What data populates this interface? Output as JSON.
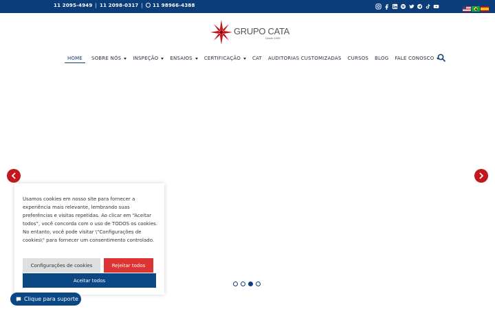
{
  "topbar": {
    "phone1": "11 2095-4949",
    "phone2": "11 2098-0317",
    "separator": "|",
    "whatsapp": "11 98966-4388",
    "social_icons": [
      "instagram-icon",
      "facebook-icon",
      "linkedin-icon",
      "spotify-icon",
      "twitter-icon",
      "telegram-icon",
      "tiktok-icon",
      "youtube-icon"
    ],
    "flags": [
      "us-flag-icon",
      "br-flag-icon",
      "es-flag-icon"
    ]
  },
  "logo": {
    "text": "GRUPO CATA",
    "sub": "Desde 1995"
  },
  "nav": {
    "items": [
      {
        "label": "HOME",
        "dropdown": false,
        "active": true
      },
      {
        "label": "SOBRE NÓS",
        "dropdown": true
      },
      {
        "label": "INSPEÇÃO",
        "dropdown": true
      },
      {
        "label": "ENSAIOS",
        "dropdown": true
      },
      {
        "label": "CERTIFICAÇÃO",
        "dropdown": true
      },
      {
        "label": "CAT",
        "dropdown": false
      },
      {
        "label": "AUDITORIAS CUSTOMIZADAS",
        "dropdown": false
      },
      {
        "label": "CURSOS",
        "dropdown": false
      },
      {
        "label": "BLOG",
        "dropdown": false
      },
      {
        "label": "FALE CONOSCO",
        "dropdown": true
      }
    ]
  },
  "slider": {
    "dot_count": 4,
    "active_dot": 3
  },
  "cookie": {
    "text": "Usamos cookies em nosso site para fornecer a experiência mais relevante, lembrando suas preferências e visitas repetidas. Ao clicar em “Aceitar todos”, você concorda com o uso de TODOS os cookies. No entanto, você pode visitar \\\"Configurações de cookies\\\" para fornecer um consentimento controlado.",
    "config_label": "Configurações de cookies",
    "reject_label": "Rejeitar todos",
    "accept_label": "Aceitar todos"
  },
  "support": {
    "label": "Clique para suporte"
  },
  "colors": {
    "brand_blue": "#0b3d7a",
    "brand_red": "#c5161d",
    "reject_red": "#dd3333"
  }
}
